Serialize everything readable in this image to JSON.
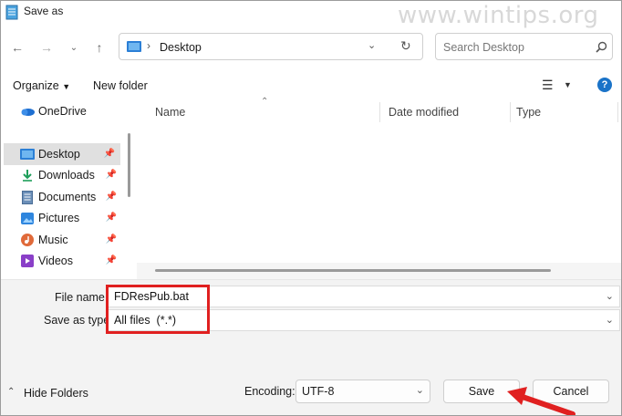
{
  "window": {
    "title": "Save as",
    "watermark": "www.wintips.org"
  },
  "nav": {
    "address_location": "Desktop",
    "search_placeholder": "Search Desktop"
  },
  "toolbar": {
    "organize_label": "Organize",
    "new_folder_label": "New folder"
  },
  "sidebar": {
    "items": [
      {
        "label": "OneDrive",
        "icon": "cloud-icon",
        "pinned": false
      },
      {
        "label": "Desktop",
        "icon": "desktop-icon",
        "pinned": true,
        "selected": true
      },
      {
        "label": "Downloads",
        "icon": "download-icon",
        "pinned": true
      },
      {
        "label": "Documents",
        "icon": "documents-icon",
        "pinned": true
      },
      {
        "label": "Pictures",
        "icon": "pictures-icon",
        "pinned": true
      },
      {
        "label": "Music",
        "icon": "music-icon",
        "pinned": true
      },
      {
        "label": "Videos",
        "icon": "videos-icon",
        "pinned": true
      }
    ]
  },
  "file_list": {
    "columns": [
      "Name",
      "Date modified",
      "Type"
    ]
  },
  "form": {
    "file_name_label": "File name:",
    "file_name_value": "FDResPub.bat",
    "save_type_label": "Save as type:",
    "save_type_value": "All files  (*.*)"
  },
  "footer": {
    "hide_folders_label": "Hide Folders",
    "encoding_label": "Encoding:",
    "encoding_value": "UTF-8",
    "save_label": "Save",
    "cancel_label": "Cancel"
  },
  "colors": {
    "highlight_red": "#e02020",
    "help_blue": "#1a73c8",
    "accent_blue": "#2b7fd6"
  }
}
